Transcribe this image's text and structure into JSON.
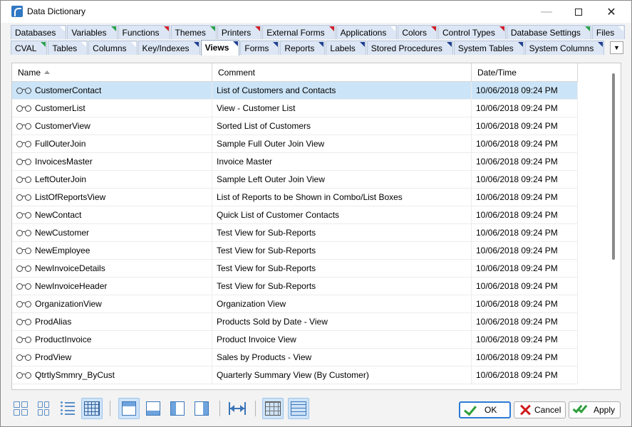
{
  "window": {
    "title": "Data Dictionary"
  },
  "tabs_row1": [
    {
      "label": "Databases",
      "corner": "white"
    },
    {
      "label": "Variables",
      "corner": "green"
    },
    {
      "label": "Functions",
      "corner": "red"
    },
    {
      "label": "Themes",
      "corner": "green"
    },
    {
      "label": "Printers",
      "corner": "red"
    },
    {
      "label": "External Forms",
      "corner": "red"
    },
    {
      "label": "Applications",
      "corner": "white"
    },
    {
      "label": "Colors",
      "corner": "red"
    },
    {
      "label": "Control Types",
      "corner": "red"
    },
    {
      "label": "Database Settings",
      "corner": "green"
    },
    {
      "label": "Files",
      "corner": "white"
    }
  ],
  "tabs_row2": [
    {
      "label": "CVAL",
      "corner": "green"
    },
    {
      "label": "Tables",
      "corner": "white"
    },
    {
      "label": "Columns",
      "corner": "white"
    },
    {
      "label": "Key/Indexes",
      "corner": "blue"
    },
    {
      "label": "Views",
      "corner": "blue",
      "active": true
    },
    {
      "label": "Forms",
      "corner": "blue"
    },
    {
      "label": "Reports",
      "corner": "blue"
    },
    {
      "label": "Labels",
      "corner": "blue"
    },
    {
      "label": "Stored Procedures",
      "corner": "blue"
    },
    {
      "label": "System Tables",
      "corner": "blue"
    },
    {
      "label": "System Columns",
      "corner": "blue"
    }
  ],
  "grid": {
    "columns": [
      "Name",
      "Comment",
      "Date/Time"
    ],
    "sort_column": "Name",
    "selected_row": 0,
    "rows": [
      [
        "CustomerContact",
        "List of Customers and Contacts",
        "10/06/2018 09:24 PM"
      ],
      [
        "CustomerList",
        "View - Customer List",
        "10/06/2018 09:24 PM"
      ],
      [
        "CustomerView",
        "Sorted List of Customers",
        "10/06/2018 09:24 PM"
      ],
      [
        "FullOuterJoin",
        "Sample Full Outer Join View",
        "10/06/2018 09:24 PM"
      ],
      [
        "InvoicesMaster",
        "Invoice Master",
        "10/06/2018 09:24 PM"
      ],
      [
        "LeftOuterJoin",
        "Sample Left Outer Join View",
        "10/06/2018 09:24 PM"
      ],
      [
        "ListOfReportsView",
        "List of Reports to be Shown in Combo/List Boxes",
        "10/06/2018 09:24 PM"
      ],
      [
        "NewContact",
        "Quick List of Customer Contacts",
        "10/06/2018 09:24 PM"
      ],
      [
        "NewCustomer",
        "Test View for Sub-Reports",
        "10/06/2018 09:24 PM"
      ],
      [
        "NewEmployee",
        "Test View for Sub-Reports",
        "10/06/2018 09:24 PM"
      ],
      [
        "NewInvoiceDetails",
        "Test View for Sub-Reports",
        "10/06/2018 09:24 PM"
      ],
      [
        "NewInvoiceHeader",
        "Test View for Sub-Reports",
        "10/06/2018 09:24 PM"
      ],
      [
        "OrganizationView",
        "Organization View",
        "10/06/2018 09:24 PM"
      ],
      [
        "ProdAlias",
        "Products Sold by Date - View",
        "10/06/2018 09:24 PM"
      ],
      [
        "ProductInvoice",
        "Product Invoice View",
        "10/06/2018 09:24 PM"
      ],
      [
        "ProdView",
        "Sales by Products - View",
        "10/06/2018 09:24 PM"
      ],
      [
        "QtrtlySmmry_ByCust",
        "Quarterly Summary View (By Customer)",
        "10/06/2018 09:24 PM"
      ]
    ]
  },
  "buttons": {
    "ok": "OK",
    "cancel": "Cancel",
    "apply": "Apply"
  },
  "toolbar_icons": [
    "large-icons-icon",
    "small-icons-icon",
    "list-view-icon",
    "details-view-icon",
    "layout-top-icon",
    "layout-bottom-icon",
    "layout-left-icon",
    "layout-right-icon",
    "autofit-columns-icon",
    "grid-lines-icon",
    "row-lines-icon"
  ]
}
